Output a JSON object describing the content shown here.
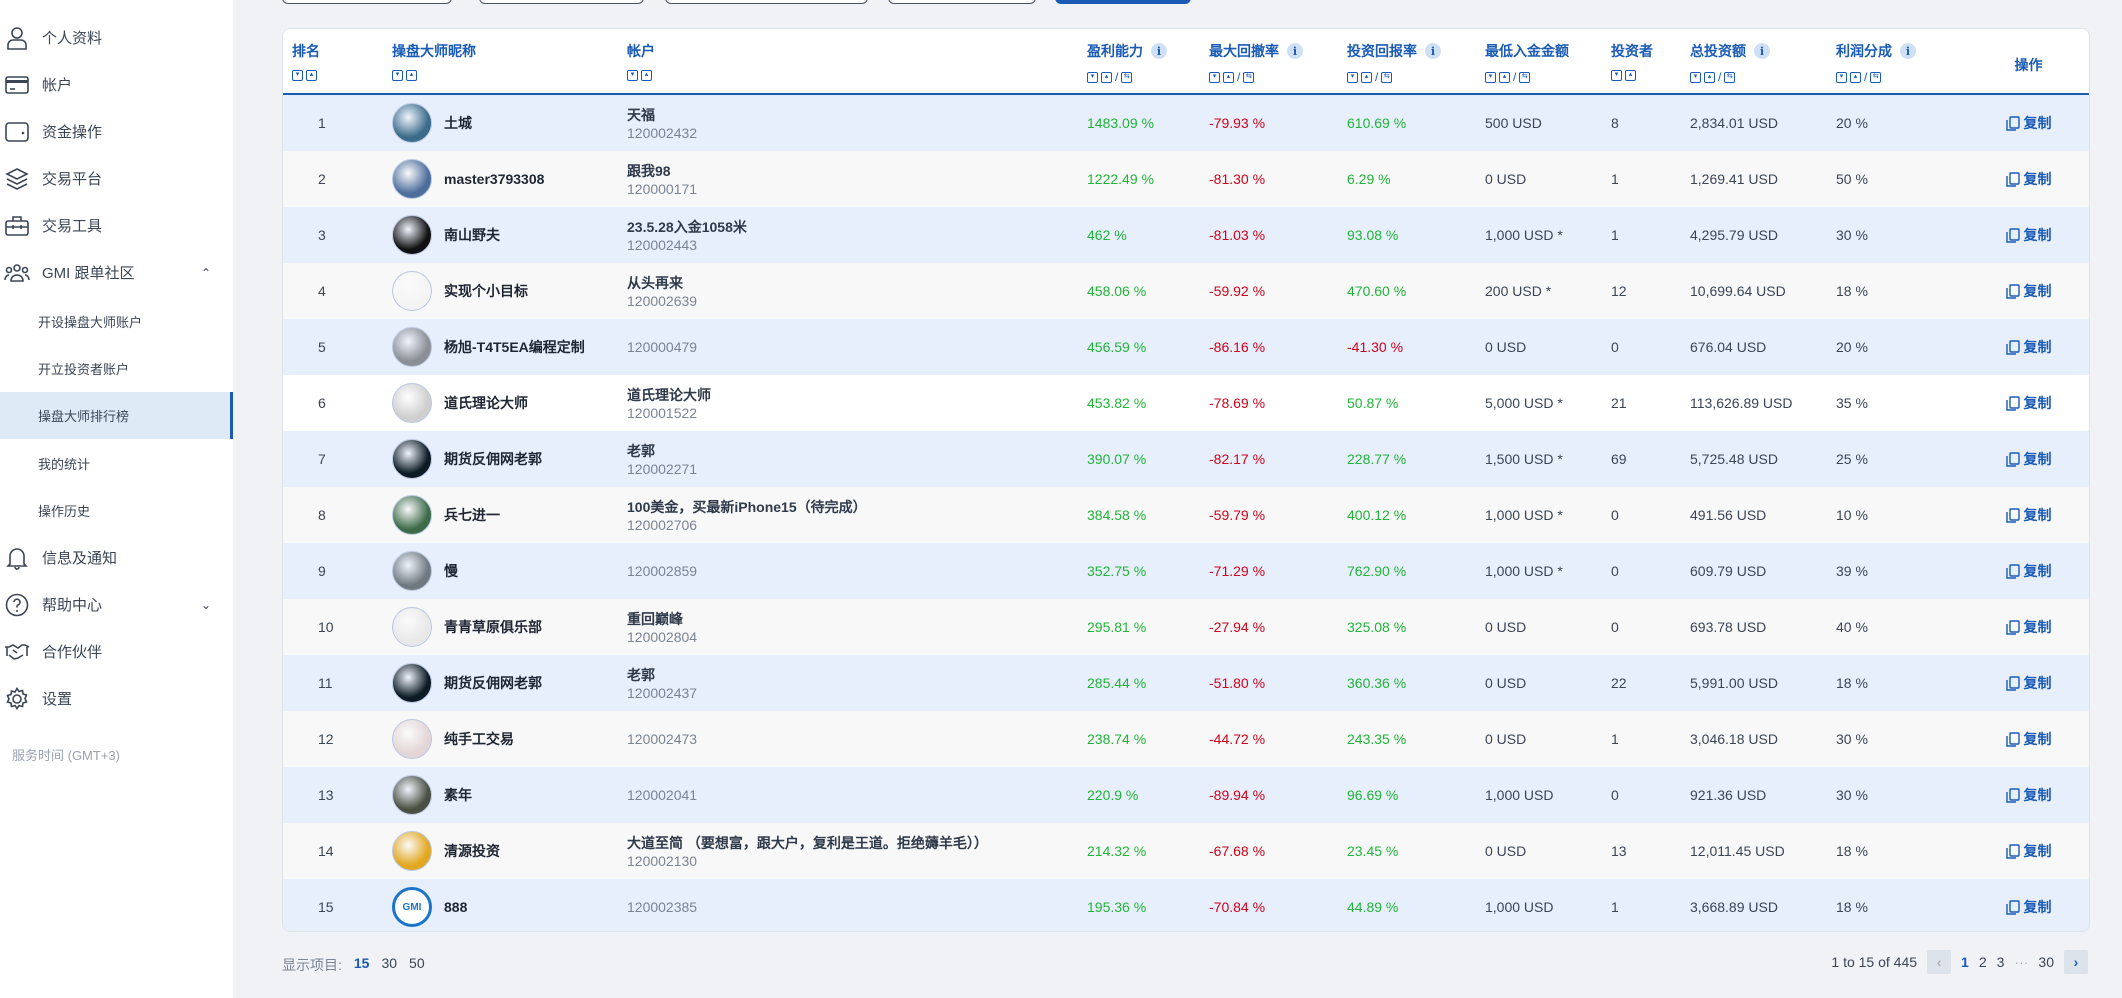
{
  "sidebar": {
    "items": [
      {
        "label": "个人资料",
        "icon": "user-icon"
      },
      {
        "label": "帐户",
        "icon": "card-icon"
      },
      {
        "label": "资金操作",
        "icon": "wallet-icon"
      },
      {
        "label": "交易平台",
        "icon": "layers-icon"
      },
      {
        "label": "交易工具",
        "icon": "toolbox-icon"
      },
      {
        "label": "GMI 跟单社区",
        "icon": "community-icon",
        "expanded": true
      },
      {
        "label": "开设操盘大师账户",
        "sub": true
      },
      {
        "label": "开立投资者账户",
        "sub": true
      },
      {
        "label": "操盘大师排行榜",
        "sub": true,
        "active": true
      },
      {
        "label": "我的统计",
        "sub": true
      },
      {
        "label": "操作历史",
        "sub": true
      },
      {
        "label": "信息及通知",
        "icon": "bell-icon"
      },
      {
        "label": "帮助中心",
        "icon": "help-icon",
        "expanded": false
      },
      {
        "label": "合作伙伴",
        "icon": "handshake-icon"
      },
      {
        "label": "设置",
        "icon": "gear-icon"
      }
    ],
    "server_time": "服务时间 (GMT+3)"
  },
  "table": {
    "headers": {
      "rank": "排名",
      "nickname": "操盘大师昵称",
      "account": "帐户",
      "profit": "盈利能力",
      "drawdown": "最大回撤率",
      "roi": "投资回报率",
      "min_deposit": "最低入金金额",
      "investors": "投资者",
      "total": "总投资额",
      "share": "利润分成",
      "action": "操作"
    },
    "copy_label": "复制",
    "rows": [
      {
        "rank": "1",
        "nick": "土城",
        "acc_name": "天福",
        "acc_id": "120002432",
        "profit": "1483.09 %",
        "dd": "-79.93 %",
        "roi": "610.69 %",
        "roi_neg": false,
        "min": "500 USD",
        "inv": "8",
        "total": "2,834.01 USD",
        "share": "20 %",
        "avatar": "#3a6b8a"
      },
      {
        "rank": "2",
        "nick": "master3793308",
        "acc_name": "跟我98",
        "acc_id": "120000171",
        "profit": "1222.49 %",
        "dd": "-81.30 %",
        "roi": "6.29 %",
        "roi_neg": false,
        "min": "0 USD",
        "inv": "1",
        "total": "1,269.41 USD",
        "share": "50 %",
        "avatar": "#4d6e9c"
      },
      {
        "rank": "3",
        "nick": "南山野夫",
        "acc_name": "23.5.28入金1058米",
        "acc_id": "120002443",
        "profit": "462 %",
        "dd": "-81.03 %",
        "roi": "93.08 %",
        "roi_neg": false,
        "min": "1,000 USD *",
        "inv": "1",
        "total": "4,295.79 USD",
        "share": "30 %",
        "avatar": "#111111"
      },
      {
        "rank": "4",
        "nick": "实现个小目标",
        "acc_name": "从头再来",
        "acc_id": "120002639",
        "profit": "458.06 %",
        "dd": "-59.92 %",
        "roi": "470.60 %",
        "roi_neg": false,
        "min": "200 USD *",
        "inv": "12",
        "total": "10,699.64 USD",
        "share": "18 %",
        "avatar": "#f4f4f4"
      },
      {
        "rank": "5",
        "nick": "杨旭-T4T5EA编程定制",
        "acc_name": "",
        "acc_id": "120000479",
        "profit": "456.59 %",
        "dd": "-86.16 %",
        "roi": "-41.30 %",
        "roi_neg": true,
        "min": "0 USD",
        "inv": "0",
        "total": "676.04 USD",
        "share": "20 %",
        "avatar": "#8a8f96"
      },
      {
        "rank": "6",
        "nick": "道氏理论大师",
        "acc_name": "道氏理论大师",
        "acc_id": "120001522",
        "profit": "453.82 %",
        "dd": "-78.69 %",
        "roi": "50.87 %",
        "roi_neg": false,
        "min": "5,000 USD *",
        "inv": "21",
        "total": "113,626.89 USD",
        "share": "35 %",
        "avatar": "#cfcfcf"
      },
      {
        "rank": "7",
        "nick": "期货反佣网老郭",
        "acc_name": "老郭",
        "acc_id": "120002271",
        "profit": "390.07 %",
        "dd": "-82.17 %",
        "roi": "228.77 %",
        "roi_neg": false,
        "min": "1,500 USD *",
        "inv": "69",
        "total": "5,725.48 USD",
        "share": "25 %",
        "avatar": "#0d1b24"
      },
      {
        "rank": "8",
        "nick": "兵七进一",
        "acc_name": "100美金，买最新iPhone15（待完成）",
        "acc_id": "120002706",
        "profit": "384.58 %",
        "dd": "-59.79 %",
        "roi": "400.12 %",
        "roi_neg": false,
        "min": "1,000 USD *",
        "inv": "0",
        "total": "491.56 USD",
        "share": "10 %",
        "avatar": "#3d6b4a"
      },
      {
        "rank": "9",
        "nick": "慢",
        "acc_name": "",
        "acc_id": "120002859",
        "profit": "352.75 %",
        "dd": "-71.29 %",
        "roi": "762.90 %",
        "roi_neg": false,
        "min": "1,000 USD *",
        "inv": "0",
        "total": "609.79 USD",
        "share": "39 %",
        "avatar": "#6f7a80"
      },
      {
        "rank": "10",
        "nick": "青青草原俱乐部",
        "acc_name": "重回巅峰",
        "acc_id": "120002804",
        "profit": "295.81 %",
        "dd": "-27.94 %",
        "roi": "325.08 %",
        "roi_neg": false,
        "min": "0 USD",
        "inv": "0",
        "total": "693.78 USD",
        "share": "40 %",
        "avatar": "#e8e8e8"
      },
      {
        "rank": "11",
        "nick": "期货反佣网老郭",
        "acc_name": "老郭",
        "acc_id": "120002437",
        "profit": "285.44 %",
        "dd": "-51.80 %",
        "roi": "360.36 %",
        "roi_neg": false,
        "min": "0 USD",
        "inv": "22",
        "total": "5,991.00 USD",
        "share": "18 %",
        "avatar": "#0d1b24"
      },
      {
        "rank": "12",
        "nick": "纯手工交易",
        "acc_name": "",
        "acc_id": "120002473",
        "profit": "238.74 %",
        "dd": "-44.72 %",
        "roi": "243.35 %",
        "roi_neg": false,
        "min": "0 USD",
        "inv": "1",
        "total": "3,046.18 USD",
        "share": "30 %",
        "avatar": "#e4d6d6"
      },
      {
        "rank": "13",
        "nick": "素年",
        "acc_name": "",
        "acc_id": "120002041",
        "profit": "220.9 %",
        "dd": "-89.94 %",
        "roi": "96.69 %",
        "roi_neg": false,
        "min": "1,000 USD",
        "inv": "0",
        "total": "921.36 USD",
        "share": "30 %",
        "avatar": "#4a4f42"
      },
      {
        "rank": "14",
        "nick": "清源投资",
        "acc_name": "大道至简 （要想富，跟大户，复利是王道。拒绝薅羊毛））",
        "acc_id": "120002130",
        "profit": "214.32 %",
        "dd": "-67.68 %",
        "roi": "23.45 %",
        "roi_neg": false,
        "min": "0 USD",
        "inv": "13",
        "total": "12,011.45 USD",
        "share": "18 %",
        "avatar": "#e2a820"
      },
      {
        "rank": "15",
        "nick": "888",
        "acc_name": "",
        "acc_id": "120002385",
        "profit": "195.36 %",
        "dd": "-70.84 %",
        "roi": "44.89 %",
        "roi_neg": false,
        "min": "1,000 USD",
        "inv": "1",
        "total": "3,668.89 USD",
        "share": "18 %",
        "avatar": "GMI"
      }
    ]
  },
  "footer": {
    "show_label": "显示项目:",
    "page_sizes": [
      "15",
      "30",
      "50"
    ],
    "selected_size": "15",
    "range": "1 to 15 of 445",
    "pages": [
      "1",
      "2",
      "3",
      "···",
      "30"
    ],
    "current_page": "1"
  },
  "colors": {
    "accent": "#1a5bb5",
    "positive": "#22b33a",
    "negative": "#d0021b"
  }
}
